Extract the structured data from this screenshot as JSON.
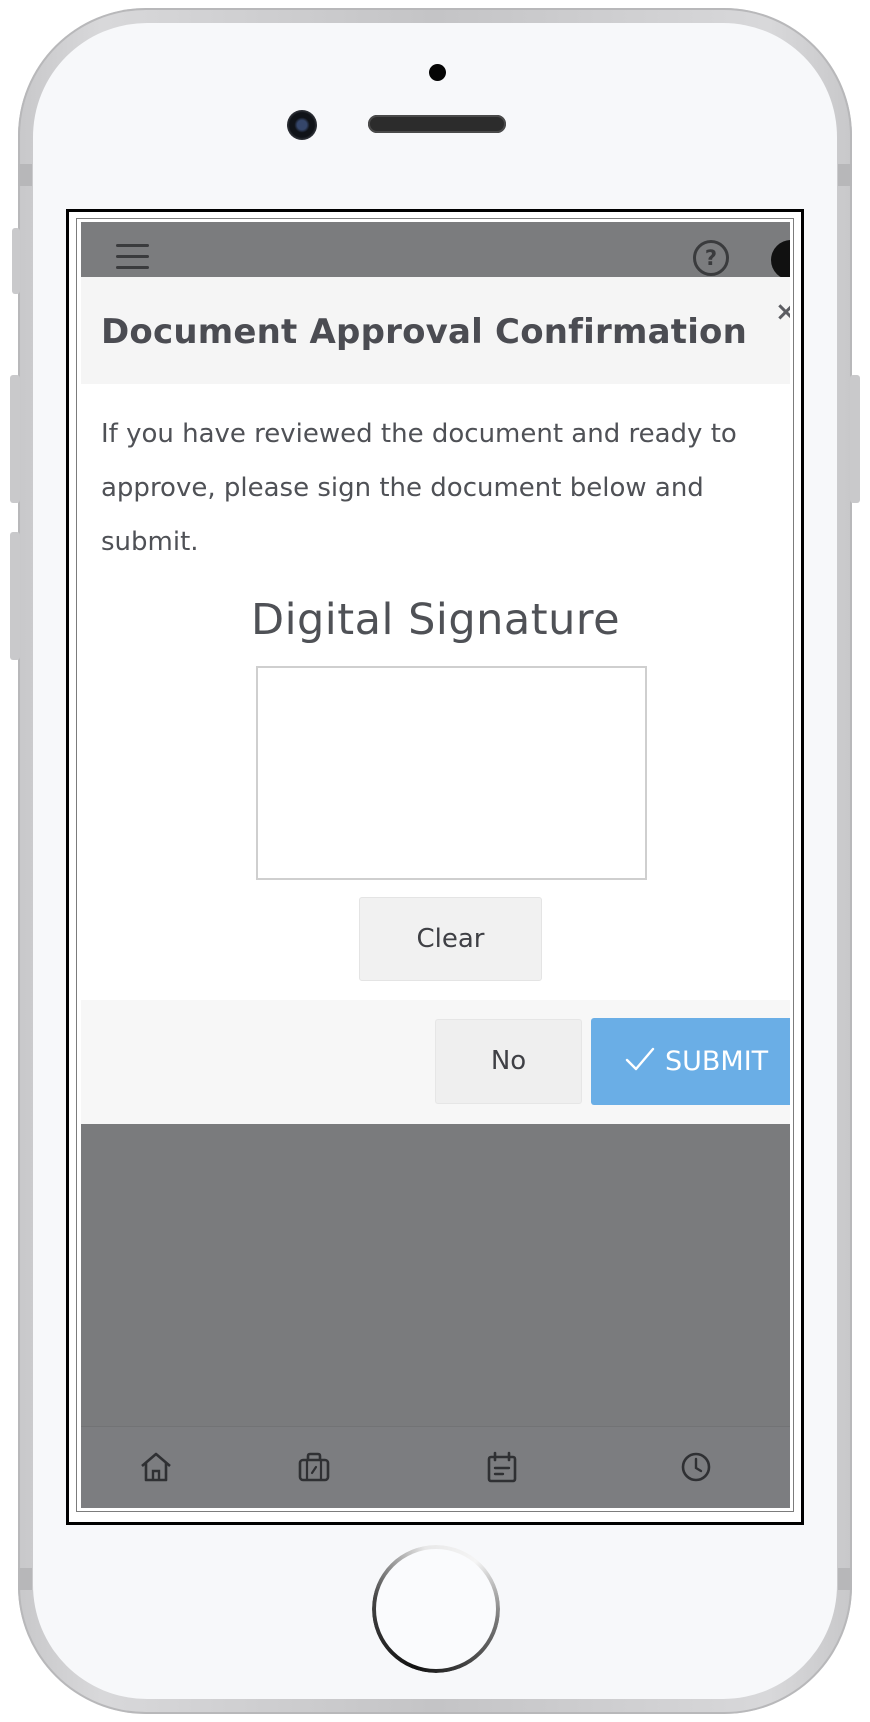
{
  "modal": {
    "title": "Document Approval Confirmation",
    "close_glyph": "×",
    "message": "If you have reviewed the document and ready to approve, please sign the document below and submit.",
    "signature_heading": "Digital Signature",
    "clear_label": "Clear",
    "no_label": "No",
    "submit_label": "SUBMIT"
  },
  "header": {
    "help_glyph": "?"
  },
  "icons": {
    "menu": "hamburger-menu-icon",
    "help": "help-circle-icon",
    "avatar": "user-avatar",
    "submit": "checkmark-icon",
    "nav": [
      "home-icon",
      "briefcase-icon",
      "calendar-icon",
      "clock-icon"
    ]
  },
  "colors": {
    "primary": "#6aaee6",
    "overlay": "#7a7b7d",
    "title_text": "#4b4c52"
  }
}
